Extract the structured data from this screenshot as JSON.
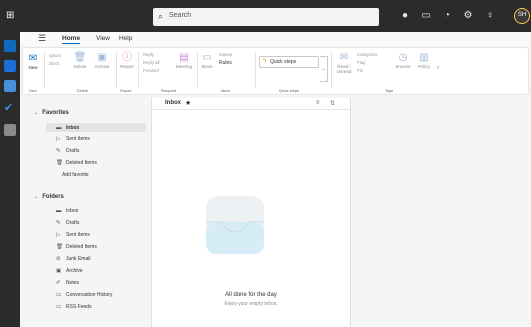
{
  "titlebar": {
    "search_placeholder": "Search",
    "avatar_initials": "SH"
  },
  "menu": {
    "tabs": [
      "Home",
      "View",
      "Help"
    ],
    "active_tab": "Home"
  },
  "ribbon": {
    "new": "New",
    "ignore": "Ignore",
    "block": "Block",
    "delete": "Delete",
    "archive": "Archive",
    "report": "Report",
    "reply": "Reply",
    "reply_all": "Reply all",
    "forward": "Forward",
    "meeting": "Meeting",
    "move": "Move",
    "sweep": "Sweep",
    "rules": "Rules",
    "quick_steps": "Quick steps",
    "read_unread": "Read / Unread",
    "categorize": "Categorize",
    "flag": "Flag",
    "pin": "Pin",
    "snooze": "Snooze",
    "policy": "Policy",
    "groups": {
      "new": "New",
      "delete": "Delete",
      "report": "Report",
      "respond": "Respond",
      "move": "Move",
      "quick_steps": "Quick steps",
      "tags": "Tags"
    }
  },
  "folders": {
    "favorites_label": "Favorites",
    "favorites": [
      {
        "label": "Inbox",
        "icon": "inbox-icon",
        "selected": true
      },
      {
        "label": "Sent Items",
        "icon": "send-icon"
      },
      {
        "label": "Drafts",
        "icon": "draft-icon"
      },
      {
        "label": "Deleted Items",
        "icon": "trash-icon"
      }
    ],
    "add_favorite": "Add favorite",
    "folders_label": "Folders",
    "items": [
      {
        "label": "Inbox",
        "icon": "inbox-icon"
      },
      {
        "label": "Drafts",
        "icon": "draft-icon"
      },
      {
        "label": "Sent Items",
        "icon": "send-icon"
      },
      {
        "label": "Deleted Items",
        "icon": "trash-icon"
      },
      {
        "label": "Junk Email",
        "icon": "junk-icon"
      },
      {
        "label": "Archive",
        "icon": "archive-icon"
      },
      {
        "label": "Notes",
        "icon": "notes-icon"
      },
      {
        "label": "Conversation History",
        "icon": "folder-icon"
      },
      {
        "label": "RSS Feeds",
        "icon": "folder-icon"
      }
    ]
  },
  "message_list": {
    "title": "Inbox",
    "empty_title": "All done for the day",
    "empty_subtitle": "Enjoy your empty inbox."
  },
  "colors": {
    "accent": "#0f6cbd",
    "titlebar": "#2b2b2b",
    "surface": "#f5f5f5"
  }
}
